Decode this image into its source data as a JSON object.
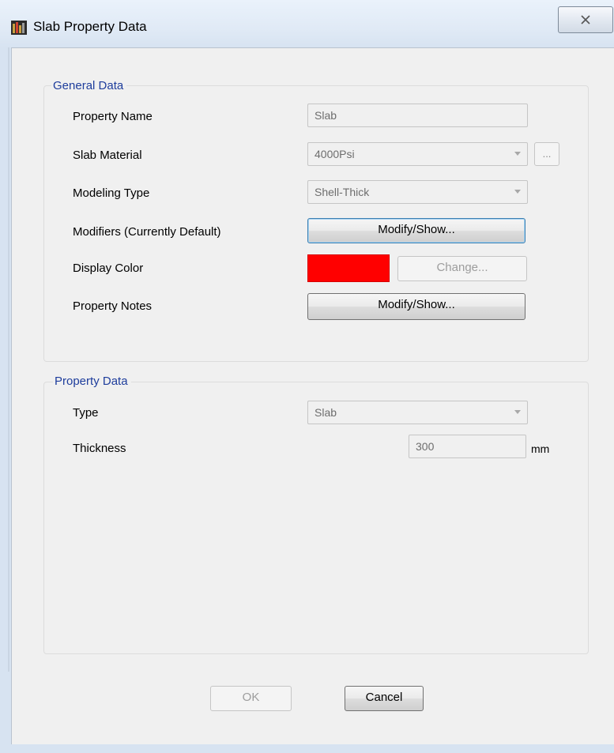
{
  "window": {
    "title": "Slab Property Data",
    "close_icon": "close-icon"
  },
  "general": {
    "legend": "General Data",
    "property_name": {
      "label": "Property Name",
      "value": "Slab"
    },
    "slab_material": {
      "label": "Slab Material",
      "value": "4000Psi",
      "browse_label": "..."
    },
    "modeling_type": {
      "label": "Modeling Type",
      "value": "Shell-Thick"
    },
    "modifiers": {
      "label": "Modifiers (Currently Default)",
      "button": "Modify/Show..."
    },
    "display_color": {
      "label": "Display Color",
      "color": "#ff0000",
      "button": "Change..."
    },
    "property_notes": {
      "label": "Property Notes",
      "button": "Modify/Show..."
    }
  },
  "property": {
    "legend": "Property Data",
    "type": {
      "label": "Type",
      "value": "Slab"
    },
    "thickness": {
      "label": "Thickness",
      "value": "300",
      "unit": "mm"
    }
  },
  "footer": {
    "ok_label": "OK",
    "cancel_label": "Cancel"
  }
}
